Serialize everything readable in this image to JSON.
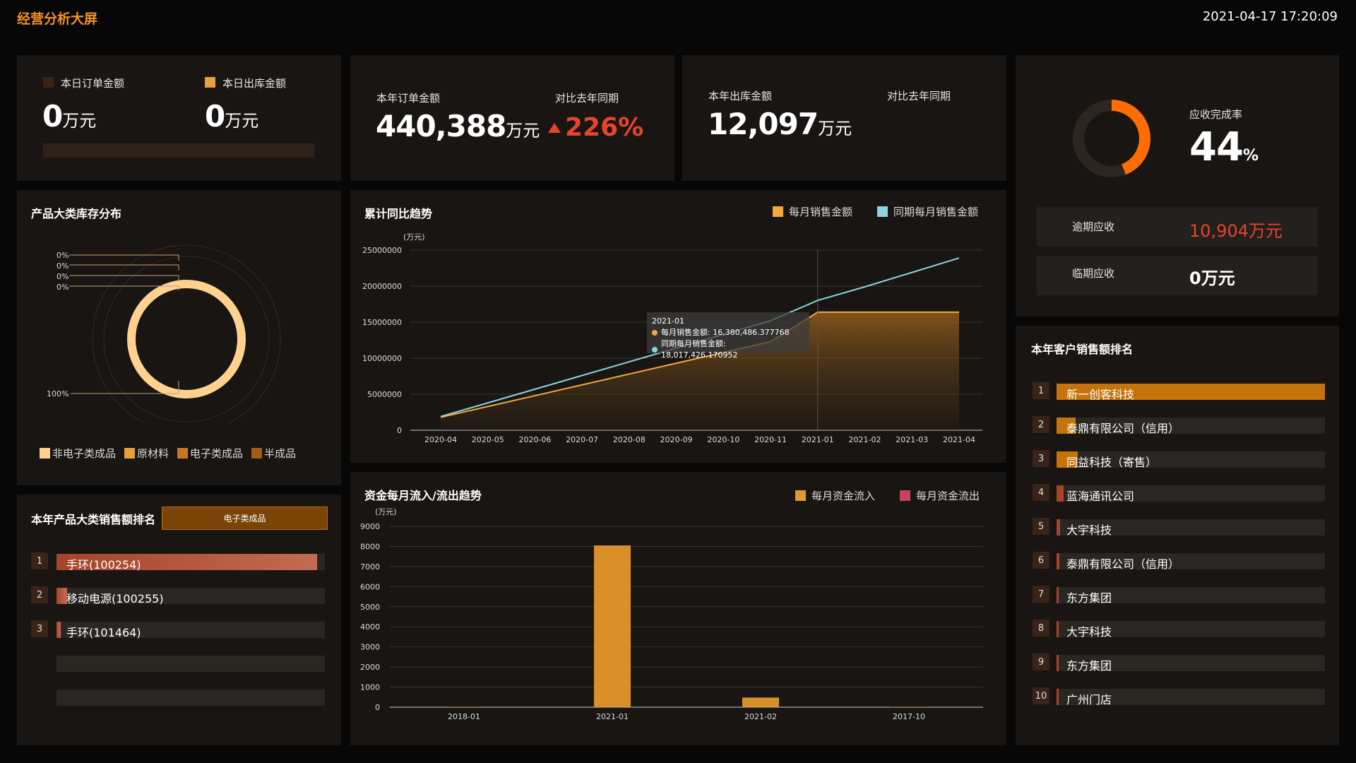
{
  "header": {
    "title": "经营分析大屏",
    "datetime": "2021-04-17 17:20:09"
  },
  "today": {
    "order_label": "本日订单金额",
    "order_value": "0",
    "order_unit": "万元",
    "ship_label": "本日出库金额",
    "ship_value": "0",
    "ship_unit": "万元",
    "colors": {
      "order": "#3a2415",
      "ship": "#e8a03c"
    }
  },
  "year_orders": {
    "label": "本年订单金额",
    "value": "440,388",
    "unit": "万元",
    "compare_label": "对比去年同期",
    "compare_value": "226%",
    "compare_color": "#e8442c"
  },
  "year_ship": {
    "label": "本年出库金额",
    "value": "12,097",
    "unit": "万元",
    "compare_label": "对比去年同期"
  },
  "receivable": {
    "rate_label": "应收完成率",
    "rate_value": "44",
    "rate_unit": "%",
    "rate_fraction": 0.44,
    "overdue_label": "逾期应收",
    "overdue_value": "10,904万元",
    "overdue_color": "#e8442c",
    "upcoming_label": "临期应收",
    "upcoming_value": "0万元"
  },
  "inventory": {
    "title": "产品大类库存分布",
    "pct_labels": [
      "0%",
      "0%",
      "0%",
      "0%",
      "100%"
    ],
    "legend": [
      {
        "name": "非电子类成品",
        "color": "#ffd18f"
      },
      {
        "name": "原材料",
        "color": "#e8a03c"
      },
      {
        "name": "电子类成品",
        "color": "#c47a25"
      },
      {
        "name": "半成品",
        "color": "#a35e13"
      }
    ]
  },
  "trend": {
    "title": "累计同比趋势",
    "legend": [
      {
        "name": "每月销售金额",
        "color": "#f3a83b"
      },
      {
        "name": "同期每月销售金额",
        "color": "#8ed3df"
      }
    ],
    "tooltip": {
      "title": "2021-01",
      "line1": "每月销售金额: 16,380,486.377768",
      "line2": "同期每月销售金额: 18,017,426.170952"
    }
  },
  "cashflow": {
    "title": "资金每月流入/流出趋势",
    "legend": [
      {
        "name": "每月资金流入",
        "color": "#e09a2e"
      },
      {
        "name": "每月资金流出",
        "color": "#c9435c"
      }
    ]
  },
  "category_rank": {
    "title": "本年产品大类销售额排名",
    "tab": "电子类成品",
    "items": [
      {
        "rank": "1",
        "label": "手环(100254)",
        "fraction": 0.97
      },
      {
        "rank": "2",
        "label": "移动电源(100255)",
        "fraction": 0.04
      },
      {
        "rank": "3",
        "label": "手环(101464)",
        "fraction": 0.015
      }
    ]
  },
  "customer_rank": {
    "title": "本年客户销售额排名",
    "items": [
      {
        "rank": "1",
        "label": "新一创客科技",
        "fraction": 1.0
      },
      {
        "rank": "2",
        "label": "泰鼎有限公司（信用）",
        "fraction": 0.07
      },
      {
        "rank": "3",
        "label": "同益科技（寄售）",
        "fraction": 0.08
      },
      {
        "rank": "4",
        "label": "蓝海通讯公司",
        "fraction": 0.025
      },
      {
        "rank": "5",
        "label": "大宇科技",
        "fraction": 0.012
      },
      {
        "rank": "6",
        "label": "泰鼎有限公司（信用）",
        "fraction": 0.01
      },
      {
        "rank": "7",
        "label": "东方集团",
        "fraction": 0.008
      },
      {
        "rank": "8",
        "label": "大宇科技",
        "fraction": 0.005
      },
      {
        "rank": "9",
        "label": "东方集团",
        "fraction": 0.004
      },
      {
        "rank": "10",
        "label": "广州门店",
        "fraction": 0.003
      }
    ]
  },
  "chart_data": [
    {
      "type": "area",
      "title": "累计同比趋势",
      "ylabel": "(万元)",
      "ylim": [
        0,
        25000000
      ],
      "yticks": [
        "25000000",
        "20000000",
        "15000000",
        "10000000",
        "5000000",
        "0"
      ],
      "categories": [
        "2020-04",
        "2020-05",
        "2020-06",
        "2020-07",
        "2020-08",
        "2020-09",
        "2020-10",
        "2020-11",
        "2021-01",
        "2021-02",
        "2021-03",
        "2021-04"
      ],
      "series": [
        {
          "name": "每月销售金额",
          "values": [
            1800000,
            3300000,
            4800000,
            6300000,
            7800000,
            9300000,
            10800000,
            12300000,
            16380486,
            16380486,
            16380486,
            16380486
          ]
        },
        {
          "name": "同期每月销售金额",
          "values": [
            1900000,
            3800000,
            5700000,
            7600000,
            9500000,
            11400000,
            13300000,
            15200000,
            18017426,
            19900000,
            21900000,
            23900000
          ]
        }
      ],
      "grid": true,
      "legend": "top-right"
    },
    {
      "type": "bar",
      "title": "资金每月流入/流出趋势",
      "ylabel": "(万元)",
      "ylim": [
        0,
        9000
      ],
      "yticks": [
        "9000",
        "8000",
        "7000",
        "6000",
        "5000",
        "4000",
        "3000",
        "2000",
        "1000",
        "0"
      ],
      "categories": [
        "2018-01",
        "2021-01",
        "2021-02",
        "2017-10"
      ],
      "series": [
        {
          "name": "每月资金流入",
          "values": [
            20,
            8050,
            480,
            0
          ]
        },
        {
          "name": "每月资金流出",
          "values": [
            0,
            0,
            0,
            0
          ]
        }
      ],
      "grid": true,
      "legend": "top-right"
    }
  ]
}
